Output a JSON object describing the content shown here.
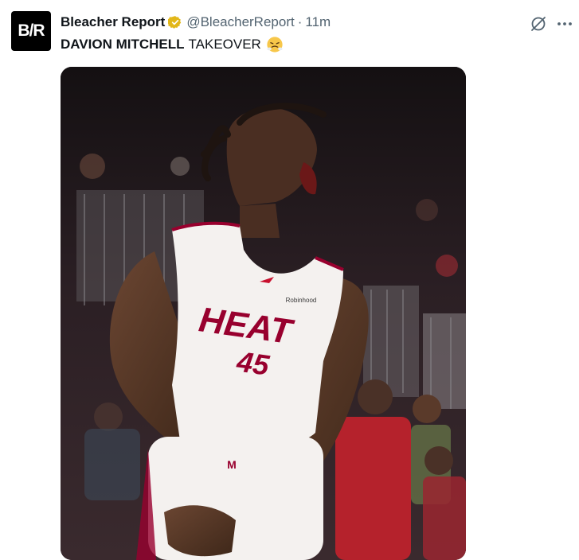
{
  "author": {
    "avatar_text": "B/R",
    "name": "Bleacher Report",
    "handle": "@BleacherReport",
    "separator": "·",
    "time": "11m"
  },
  "tweet": {
    "text_bold": "DAVION MITCHELL",
    "text_rest": "TAKEOVER",
    "emoji": "face-with-steam-from-nose"
  },
  "media": {
    "jersey_team": "HEAT",
    "jersey_number": "45",
    "jersey_sponsor": "Robinhood",
    "shorts_logo": "M"
  },
  "icons": {
    "verified": "verified-badge-icon",
    "grok": "grok-icon",
    "more": "more-icon"
  },
  "colors": {
    "verified_gold": "#e2b719",
    "text_primary": "#0f1419",
    "text_secondary": "#536471",
    "heat_red": "#98002e"
  }
}
